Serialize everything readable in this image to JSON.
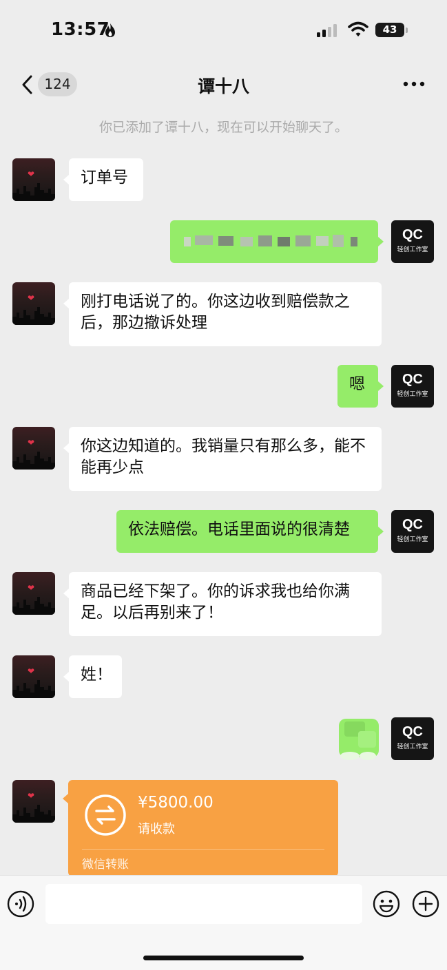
{
  "status_bar": {
    "time": "13:57",
    "battery": "43"
  },
  "header": {
    "unread_count": "124",
    "title": "谭十八"
  },
  "system_message": "你已添加了谭十八，现在可以开始聊天了。",
  "avatar_right_logo": {
    "mark": "QC",
    "text": "轻创工作室"
  },
  "messages": [
    {
      "side": "left",
      "text": "订单号"
    },
    {
      "side": "right",
      "text": "",
      "redacted": true
    },
    {
      "side": "left",
      "text": "刚打电话说了的。你这边收到赔偿款之后，那边撤诉处理"
    },
    {
      "side": "right",
      "text": "嗯"
    },
    {
      "side": "left",
      "text": "你这边知道的。我销量只有那么多，能不能再少点"
    },
    {
      "side": "right",
      "text": "依法赔偿。电话里面说的很清楚"
    },
    {
      "side": "left",
      "text": "商品已经下架了。你的诉求我也给你满足。以后再别来了！"
    },
    {
      "side": "left",
      "text": "姓！"
    },
    {
      "side": "right",
      "text": "",
      "sticker": true
    }
  ],
  "transfer": {
    "amount": "¥5800.00",
    "status": "请收款",
    "footer": "微信转账",
    "color": "#f8a143"
  },
  "input": {
    "placeholder": ""
  },
  "colors": {
    "bubble_right": "#95ec69",
    "bubble_left": "#ffffff",
    "background": "#ededed"
  }
}
